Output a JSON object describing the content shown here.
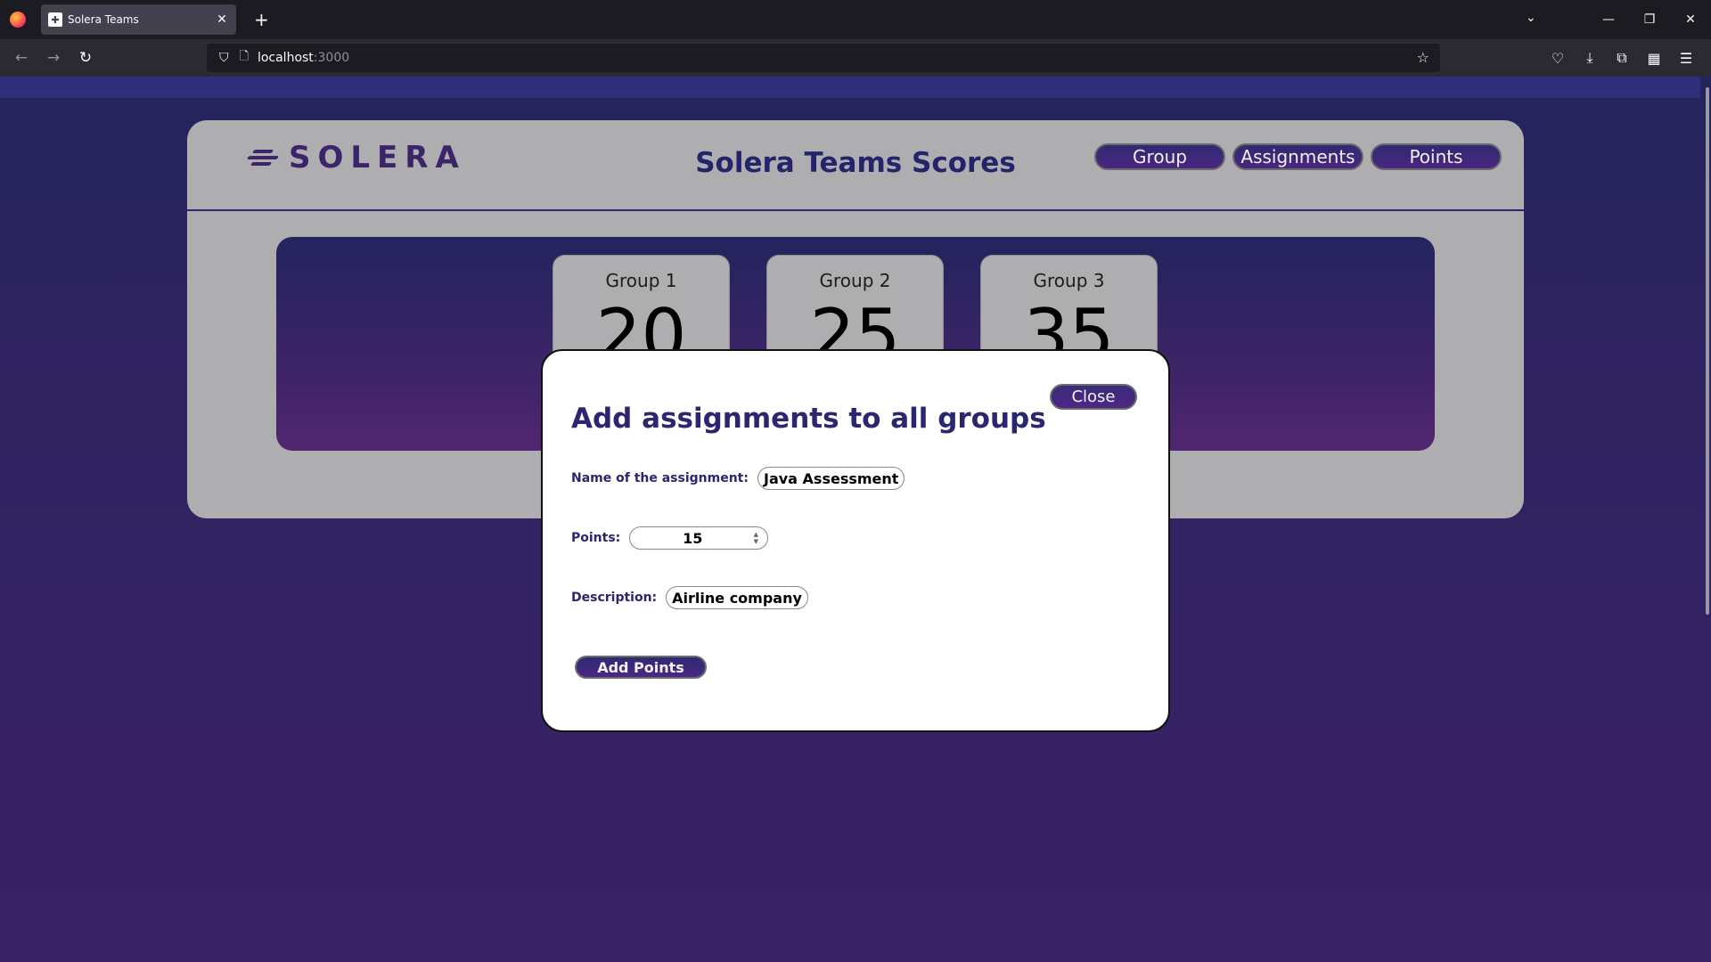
{
  "browser": {
    "tab_title": "Solera Teams",
    "url_host": "localhost",
    "url_port": ":3000"
  },
  "header": {
    "logo_text": "SOLERA",
    "title": "Solera Teams Scores",
    "nav": [
      "Group",
      "Assignments",
      "Points"
    ]
  },
  "groups": [
    {
      "name": "Group 1",
      "score": "20"
    },
    {
      "name": "Group 2",
      "score": "25"
    },
    {
      "name": "Group 3",
      "score": "35"
    }
  ],
  "modal": {
    "title": "Add assignments to all groups",
    "close_label": "Close",
    "name_label": "Name of the assignment:",
    "name_value": "Java Assessment",
    "points_label": "Points:",
    "points_value": "15",
    "description_label": "Description:",
    "description_value": "Airline company",
    "submit_label": "Add Points"
  },
  "colors": {
    "brand_purple": "#3b2568",
    "title_navy": "#23246a",
    "card_gray": "#aeadaf"
  }
}
